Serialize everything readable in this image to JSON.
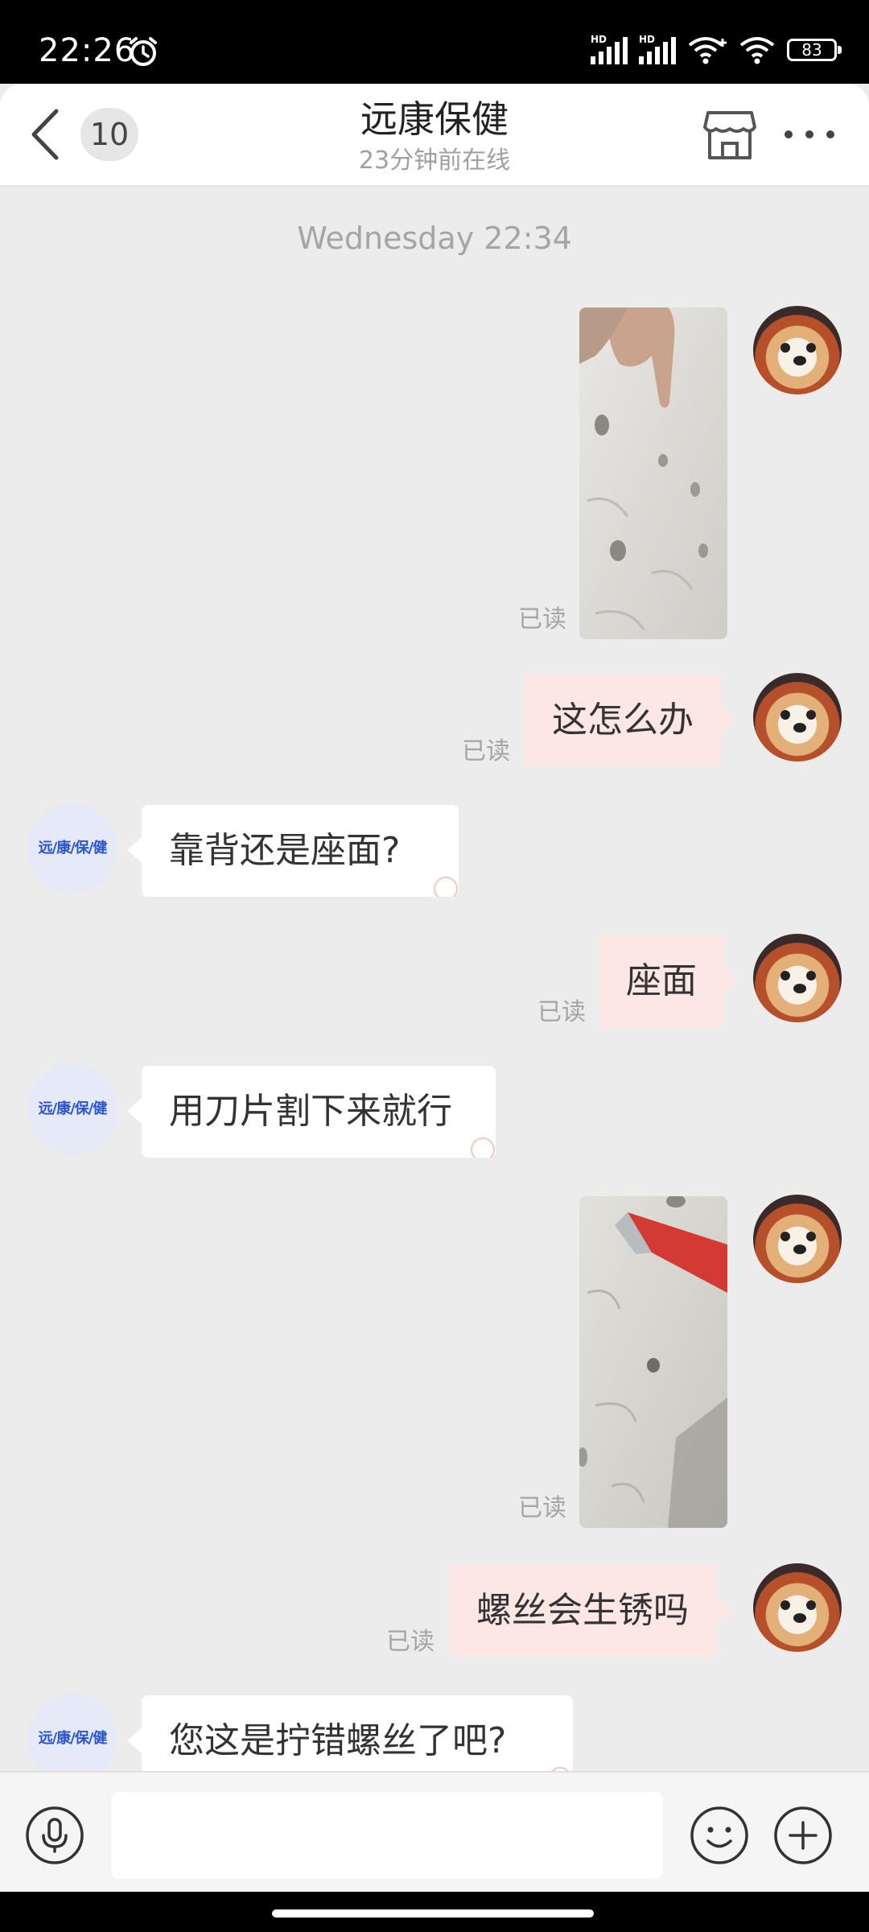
{
  "status_bar": {
    "time": "22:26",
    "signal_label_1": "HD",
    "signal_label_2": "HD",
    "battery": "83"
  },
  "header": {
    "unread_count": "10",
    "title": "远康保健",
    "subtitle": "23分钟前在线"
  },
  "chat": {
    "timestamp": "Wednesday 22:34",
    "read_label": "已读",
    "shop_avatar_text": "远/康/保/健",
    "messages": [
      {
        "from": "me",
        "type": "image",
        "read": "已读"
      },
      {
        "from": "me",
        "type": "text",
        "text": "这怎么办",
        "read": "已读"
      },
      {
        "from": "shop",
        "type": "text",
        "text": "靠背还是座面?"
      },
      {
        "from": "me",
        "type": "text",
        "text": "座面",
        "read": "已读"
      },
      {
        "from": "shop",
        "type": "text",
        "text": "用刀片割下来就行"
      },
      {
        "from": "me",
        "type": "image",
        "read": "已读"
      },
      {
        "from": "me",
        "type": "text",
        "text": "螺丝会生锈吗",
        "read": "已读"
      },
      {
        "from": "shop",
        "type": "text",
        "text": "您这是拧错螺丝了吧?"
      }
    ]
  },
  "input_bar": {
    "placeholder": ""
  },
  "icons": {
    "back": "chevron-left-icon",
    "shop": "store-icon",
    "more": "more-dots-icon",
    "voice": "microphone-icon",
    "emoji": "emoji-icon",
    "plus": "plus-icon",
    "alarm": "alarm-icon",
    "wifi": "wifi-icon"
  },
  "colors": {
    "my_bubble": "#fde7e5",
    "shop_bubble": "#ffffff",
    "background": "#ececec",
    "shop_avatar_text": "#2b55c9"
  }
}
